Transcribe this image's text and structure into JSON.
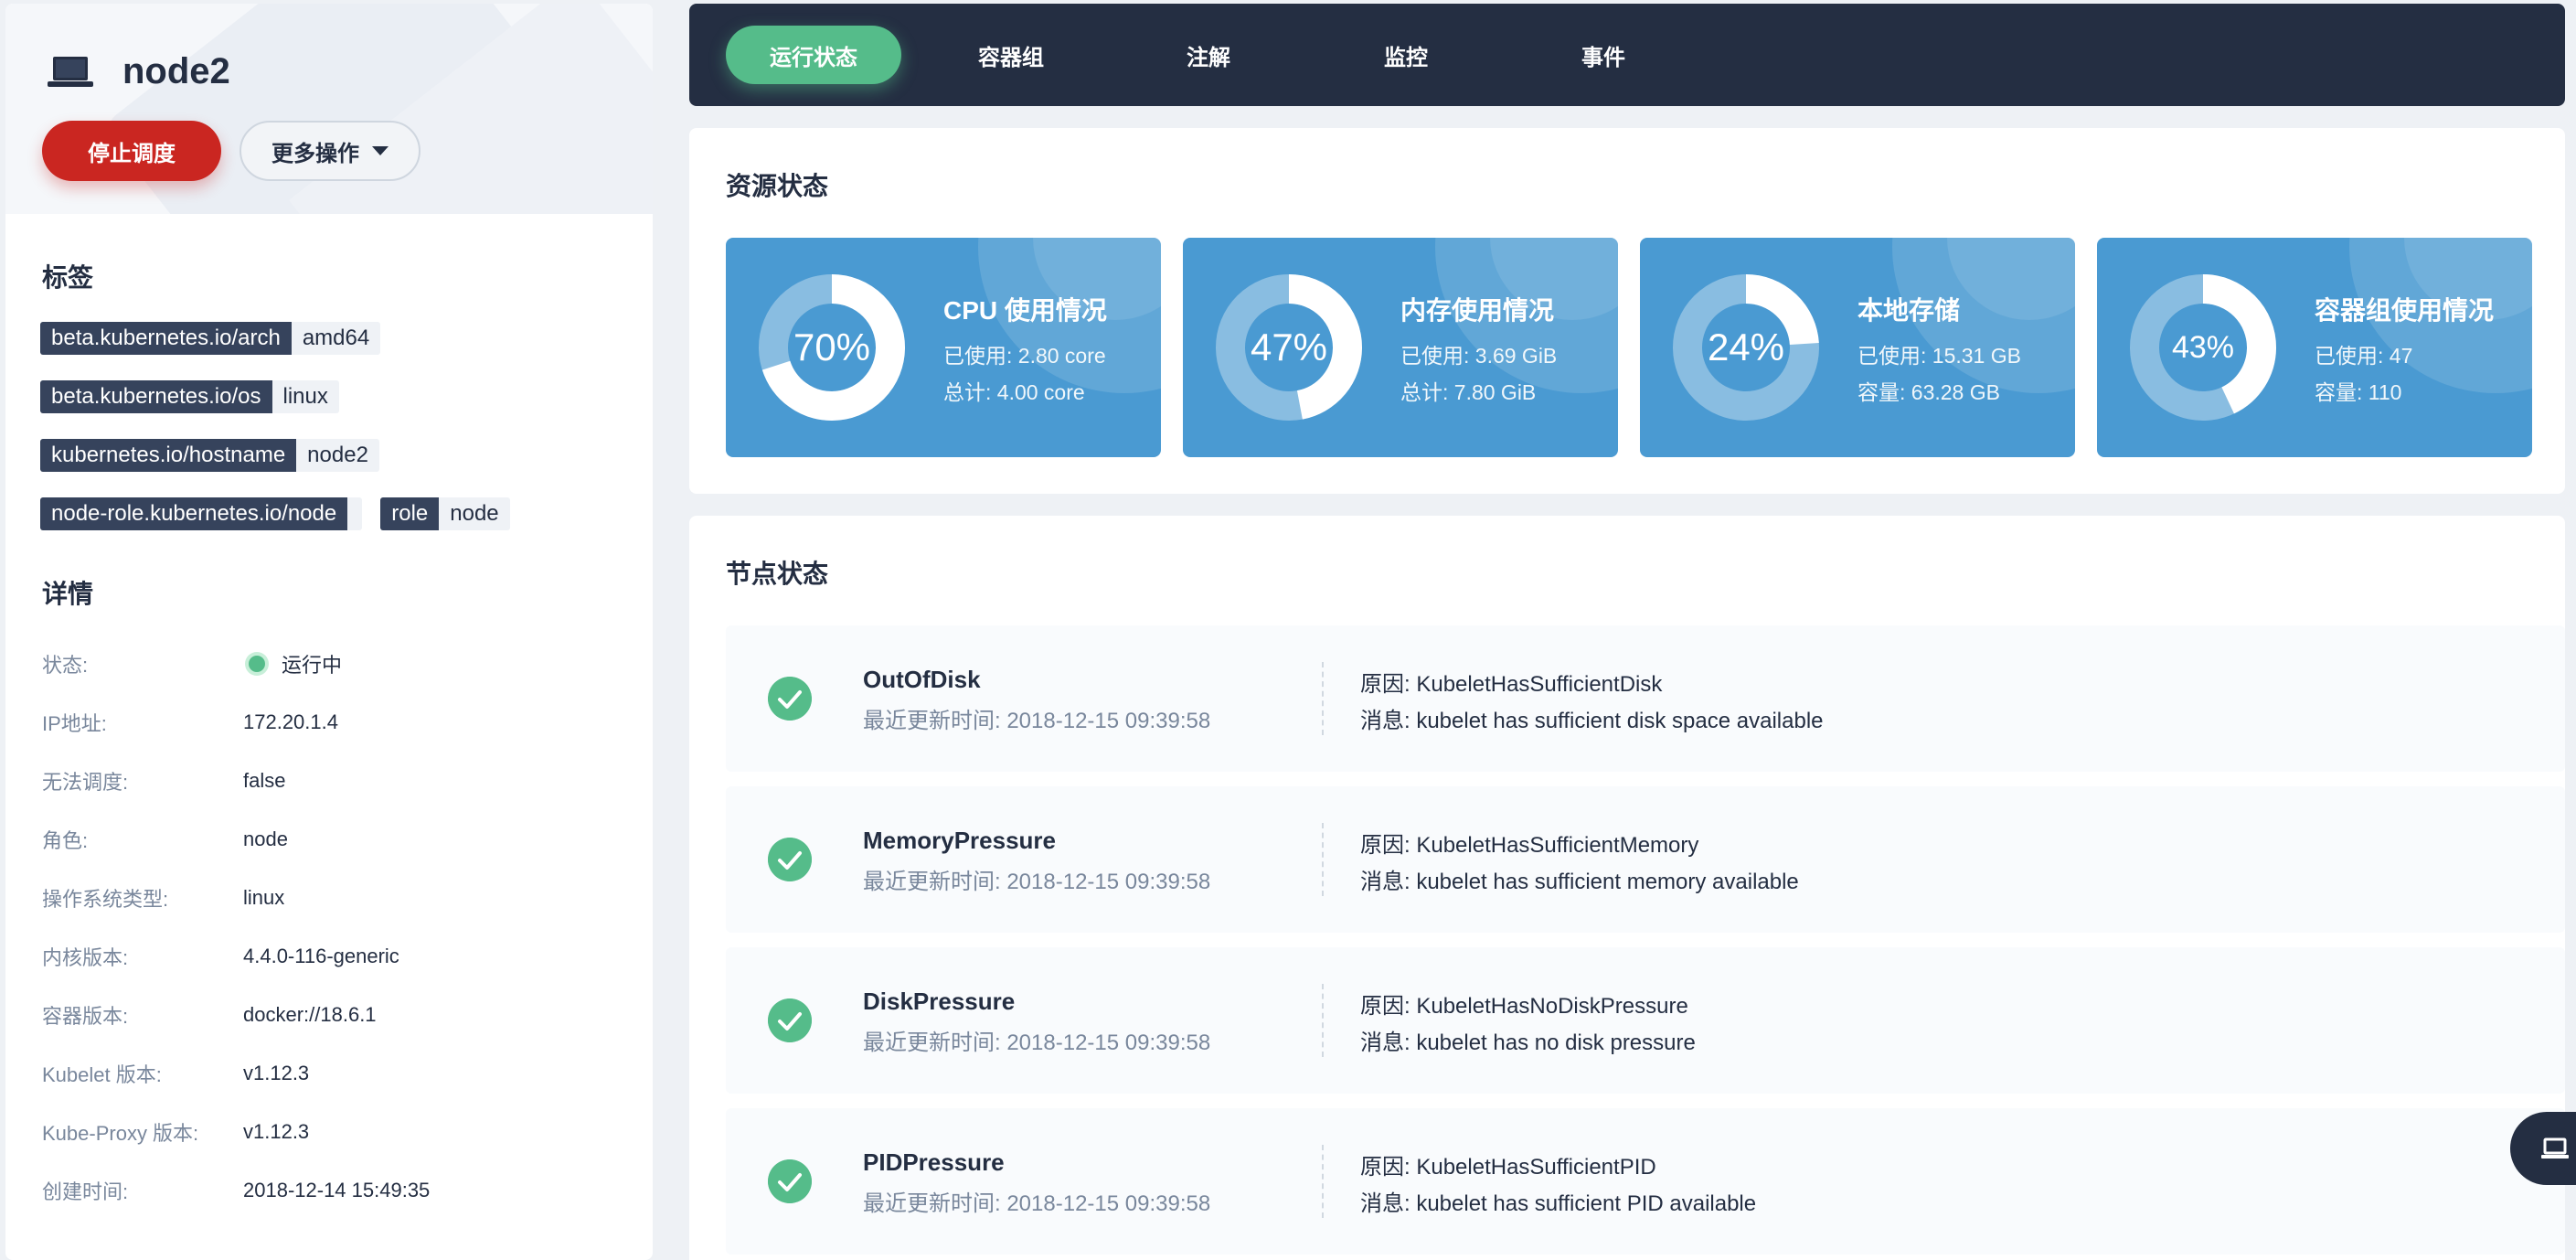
{
  "node": {
    "name": "node2",
    "stop_schedule_label": "停止调度",
    "more_actions_label": "更多操作"
  },
  "labels_section": {
    "title": "标签",
    "items": [
      {
        "key": "beta.kubernetes.io/arch",
        "value": "amd64"
      },
      {
        "key": "beta.kubernetes.io/os",
        "value": "linux"
      },
      {
        "key": "kubernetes.io/hostname",
        "value": "node2"
      },
      {
        "key": "node-role.kubernetes.io/node",
        "value": ""
      },
      {
        "key": "role",
        "value": "node"
      }
    ]
  },
  "details": {
    "title": "详情",
    "rows": [
      {
        "key": "状态:",
        "value": "运行中"
      },
      {
        "key": "IP地址:",
        "value": "172.20.1.4"
      },
      {
        "key": "无法调度:",
        "value": "false"
      },
      {
        "key": "角色:",
        "value": "node"
      },
      {
        "key": "操作系统类型:",
        "value": "linux"
      },
      {
        "key": "内核版本:",
        "value": "4.4.0-116-generic"
      },
      {
        "key": "容器版本:",
        "value": "docker://18.6.1"
      },
      {
        "key": "Kubelet 版本:",
        "value": "v1.12.3"
      },
      {
        "key": "Kube-Proxy 版本:",
        "value": "v1.12.3"
      },
      {
        "key": "创建时间:",
        "value": "2018-12-14 15:49:35"
      }
    ]
  },
  "tabs": [
    {
      "label": "运行状态",
      "active": true
    },
    {
      "label": "容器组",
      "active": false
    },
    {
      "label": "注解",
      "active": false
    },
    {
      "label": "监控",
      "active": false
    },
    {
      "label": "事件",
      "active": false
    }
  ],
  "resources": {
    "title": "资源状态",
    "cards": [
      {
        "name": "CPU 使用情况",
        "percent_label": "70%",
        "percent": 0.7,
        "line1": "已使用: 2.80 core",
        "line2": "总计: 4.00 core"
      },
      {
        "name": "内存使用情况",
        "percent_label": "47%",
        "percent": 0.47,
        "line1": "已使用: 3.69 GiB",
        "line2": "总计: 7.80 GiB"
      },
      {
        "name": "本地存储",
        "percent_label": "24%",
        "percent": 0.24,
        "line1": "已使用: 15.31 GB",
        "line2": "容量: 63.28 GB"
      },
      {
        "name": "容器组使用情况",
        "percent_label": "43%",
        "percent": 0.43,
        "line1": "已使用: 47",
        "line2": "容量: 110"
      }
    ]
  },
  "conditions": {
    "title": "节点状态",
    "rows": [
      {
        "name": "OutOfDisk",
        "time": "最近更新时间: 2018-12-15 09:39:58",
        "reason": "原因: KubeletHasSufficientDisk",
        "message": "消息: kubelet has sufficient disk space available"
      },
      {
        "name": "MemoryPressure",
        "time": "最近更新时间: 2018-12-15 09:39:58",
        "reason": "原因: KubeletHasSufficientMemory",
        "message": "消息: kubelet has sufficient memory available"
      },
      {
        "name": "DiskPressure",
        "time": "最近更新时间: 2018-12-15 09:39:58",
        "reason": "原因: KubeletHasNoDiskPressure",
        "message": "消息: kubelet has no disk pressure"
      },
      {
        "name": "PIDPressure",
        "time": "最近更新时间: 2018-12-15 09:39:58",
        "reason": "原因: KubeletHasSufficientPID",
        "message": "消息: kubelet has sufficient PID available"
      }
    ]
  },
  "colors": {
    "accent_green": "#55bc8a",
    "danger_red": "#ca2621",
    "nav_dark": "#242e42",
    "card_blue": "#4a9ad2"
  }
}
